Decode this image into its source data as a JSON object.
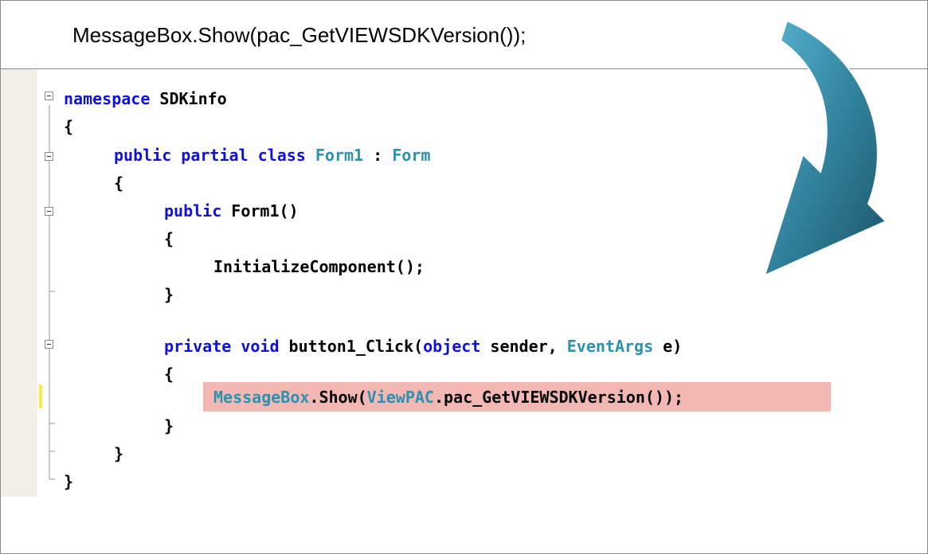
{
  "header": {
    "text": "MessageBox.Show(pac_GetVIEWSDKVersion());"
  },
  "code": {
    "namespace_kw": "namespace",
    "namespace_name": "SDKinfo",
    "brace_open": "{",
    "brace_close": "}",
    "class_kw": "public partial class",
    "class_name": "Form1",
    "class_sep": " : ",
    "class_base": "Form",
    "ctor_kw": "public",
    "ctor_name": " Form1()",
    "init_call": "InitializeComponent();",
    "method_kw1": "private",
    "method_kw2": "void",
    "method_name": " button1_Click(",
    "param_kw": "object",
    "param_sender": " sender, ",
    "param_type": "EventArgs",
    "param_e": " e)",
    "call_type1": "MessageBox",
    "call_show": ".Show(",
    "call_type2": "ViewPAC",
    "call_rest": ".pac_GetVIEWSDKVersion());"
  },
  "colors": {
    "keyword": "#1010d8",
    "type": "#2b91af",
    "highlight": "#f4b8b4",
    "gutter": "#f1f0e6",
    "arrow": "#2e7a93"
  },
  "icons": [
    "collapse-box-icon",
    "curved-arrow-icon"
  ]
}
